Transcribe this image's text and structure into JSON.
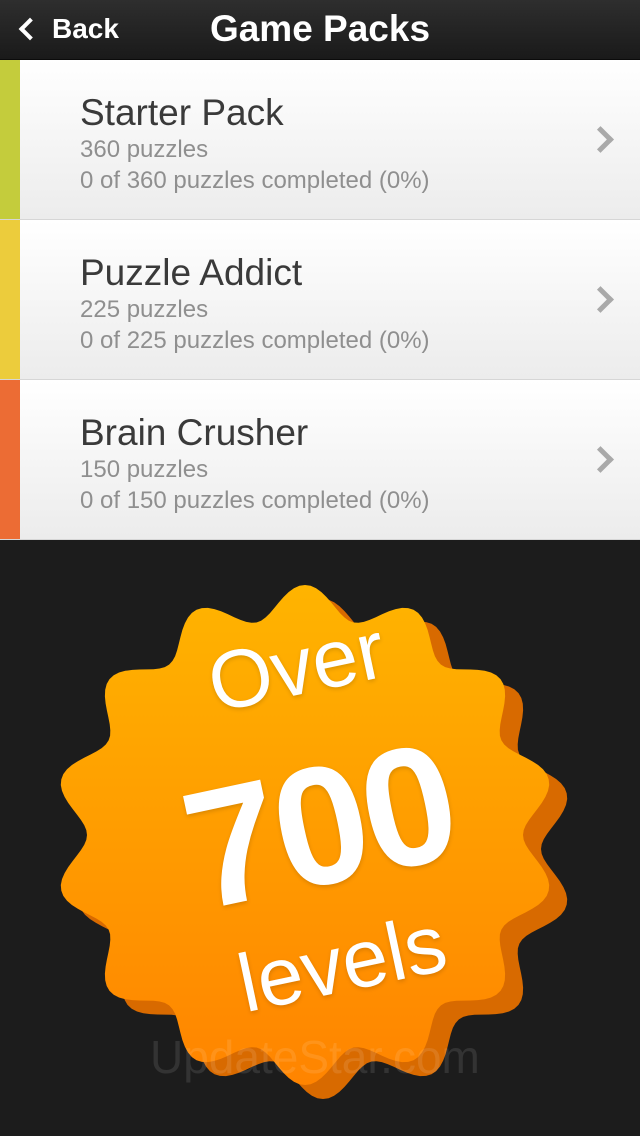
{
  "navbar": {
    "back_label": "Back",
    "title": "Game Packs"
  },
  "packs": [
    {
      "name": "Starter Pack",
      "count": "360 puzzles",
      "progress": "0 of 360 puzzles completed (0%)",
      "accent_color": "#c4cc3c"
    },
    {
      "name": "Puzzle Addict",
      "count": "225 puzzles",
      "progress": "0 of 225 puzzles completed (0%)",
      "accent_color": "#eccc3c"
    },
    {
      "name": "Brain Crusher",
      "count": "150 puzzles",
      "progress": "0 of 150 puzzles completed (0%)",
      "accent_color": "#ec6c34"
    }
  ],
  "promo": {
    "line1": "Over",
    "line2": "700",
    "line3": "levels",
    "badge_color": "#ff9900",
    "badge_shadow_color": "#d86a00"
  },
  "watermark": "UpdateStar.com"
}
